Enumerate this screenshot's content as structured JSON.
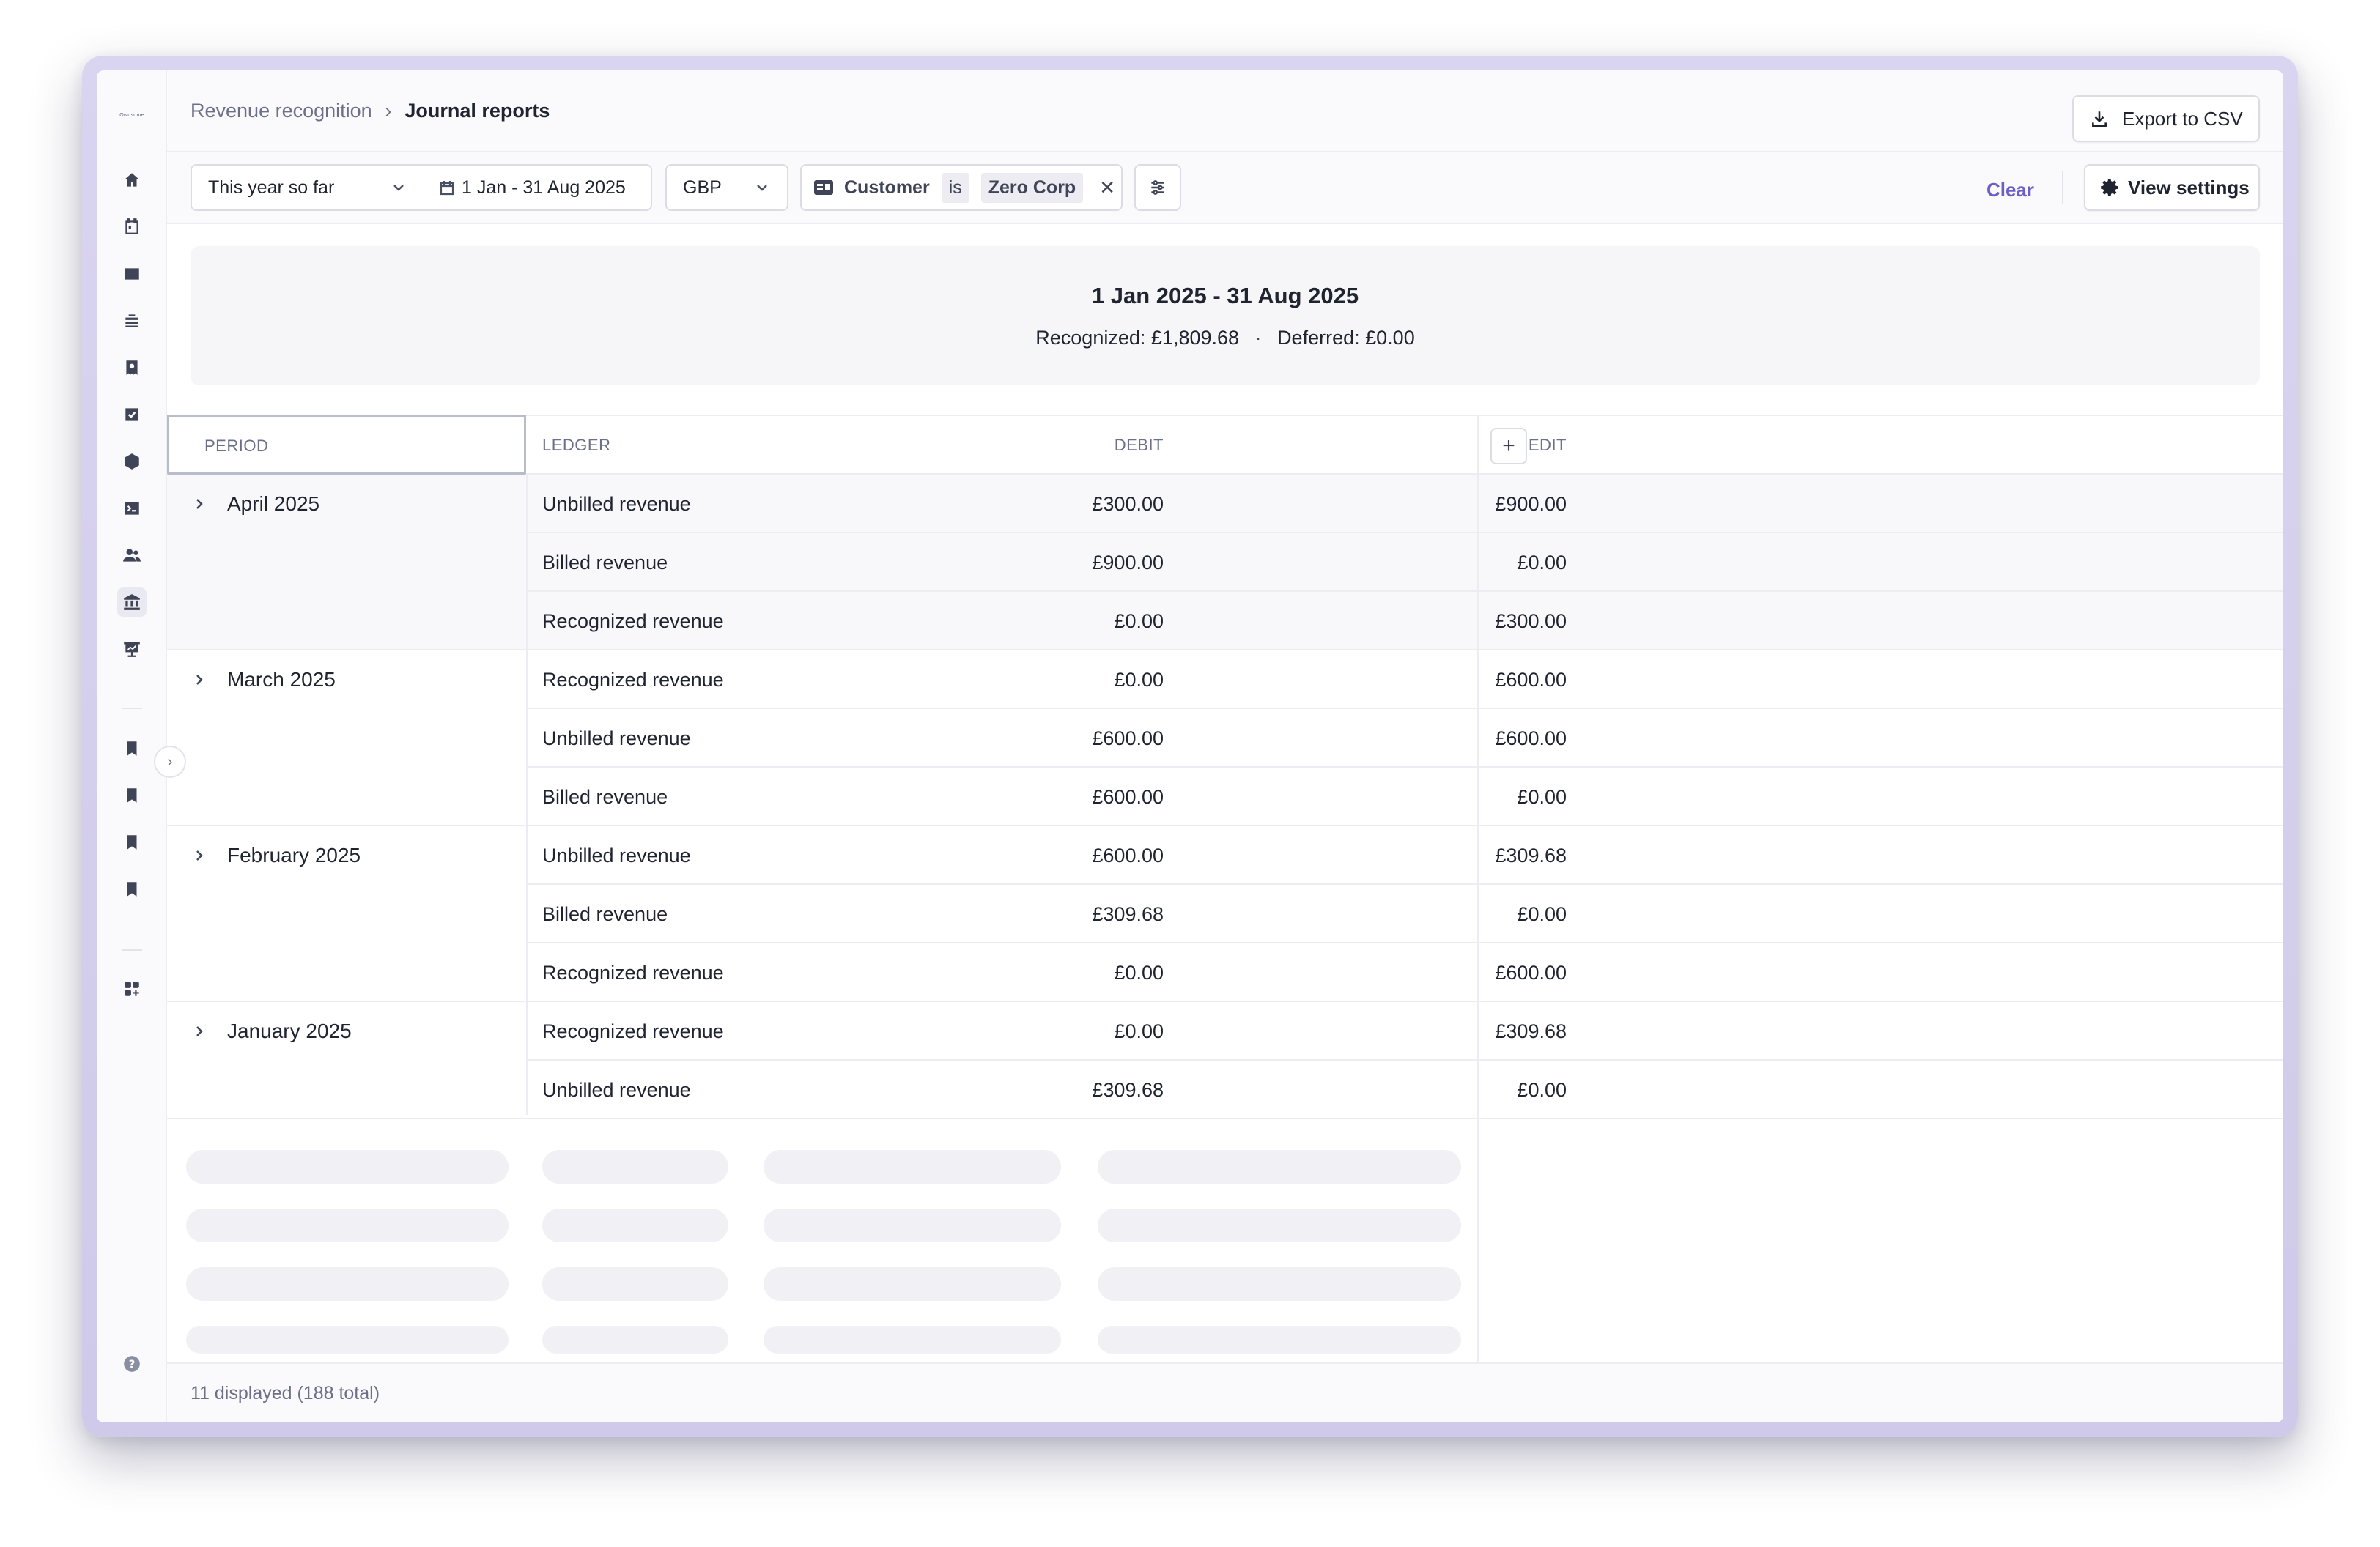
{
  "breadcrumb": {
    "parent": "Revenue recognition",
    "current": "Journal reports"
  },
  "rail": {
    "logo": "Ownsome"
  },
  "toolbar": {
    "export_label": "Export to CSV"
  },
  "filters": {
    "period": "This year so far",
    "date_range": "1 Jan - 31 Aug 2025",
    "currency": "GBP",
    "chip": {
      "field": "Customer",
      "operator": "is",
      "value": "Zero Corp"
    },
    "clear_label": "Clear",
    "view_settings_label": "View settings"
  },
  "summary": {
    "range": "1 Jan 2025 - 31 Aug 2025",
    "recognized_label": "Recognized:",
    "recognized_value": "£1,809.68",
    "separator": "·",
    "deferred_label": "Deferred:",
    "deferred_value": "£0.00"
  },
  "table": {
    "columns": {
      "period": "PERIOD",
      "ledger": "LEDGER",
      "debit": "DEBIT",
      "credit": "CREDIT"
    },
    "groups": [
      {
        "period": "April 2025",
        "rows": [
          {
            "ledger": "Unbilled revenue",
            "debit": "£300.00",
            "credit": "£900.00"
          },
          {
            "ledger": "Billed revenue",
            "debit": "£900.00",
            "credit": "£0.00"
          },
          {
            "ledger": "Recognized revenue",
            "debit": "£0.00",
            "credit": "£300.00"
          }
        ]
      },
      {
        "period": "March 2025",
        "rows": [
          {
            "ledger": "Recognized revenue",
            "debit": "£0.00",
            "credit": "£600.00"
          },
          {
            "ledger": "Unbilled revenue",
            "debit": "£600.00",
            "credit": "£600.00"
          },
          {
            "ledger": "Billed revenue",
            "debit": "£600.00",
            "credit": "£0.00"
          }
        ]
      },
      {
        "period": "February 2025",
        "rows": [
          {
            "ledger": "Unbilled revenue",
            "debit": "£600.00",
            "credit": "£309.68"
          },
          {
            "ledger": "Billed revenue",
            "debit": "£309.68",
            "credit": "£0.00"
          },
          {
            "ledger": "Recognized revenue",
            "debit": "£0.00",
            "credit": "£600.00"
          }
        ]
      },
      {
        "period": "January 2025",
        "rows": [
          {
            "ledger": "Recognized revenue",
            "debit": "£0.00",
            "credit": "£309.68"
          },
          {
            "ledger": "Unbilled revenue",
            "debit": "£309.68",
            "credit": "£0.00"
          }
        ]
      }
    ]
  },
  "footer": {
    "count_text": "11 displayed (188 total)"
  },
  "colors": {
    "accent": "#6a5fc9",
    "border": "#ececf2",
    "text": "#1f2430",
    "muted": "#6b7088"
  }
}
